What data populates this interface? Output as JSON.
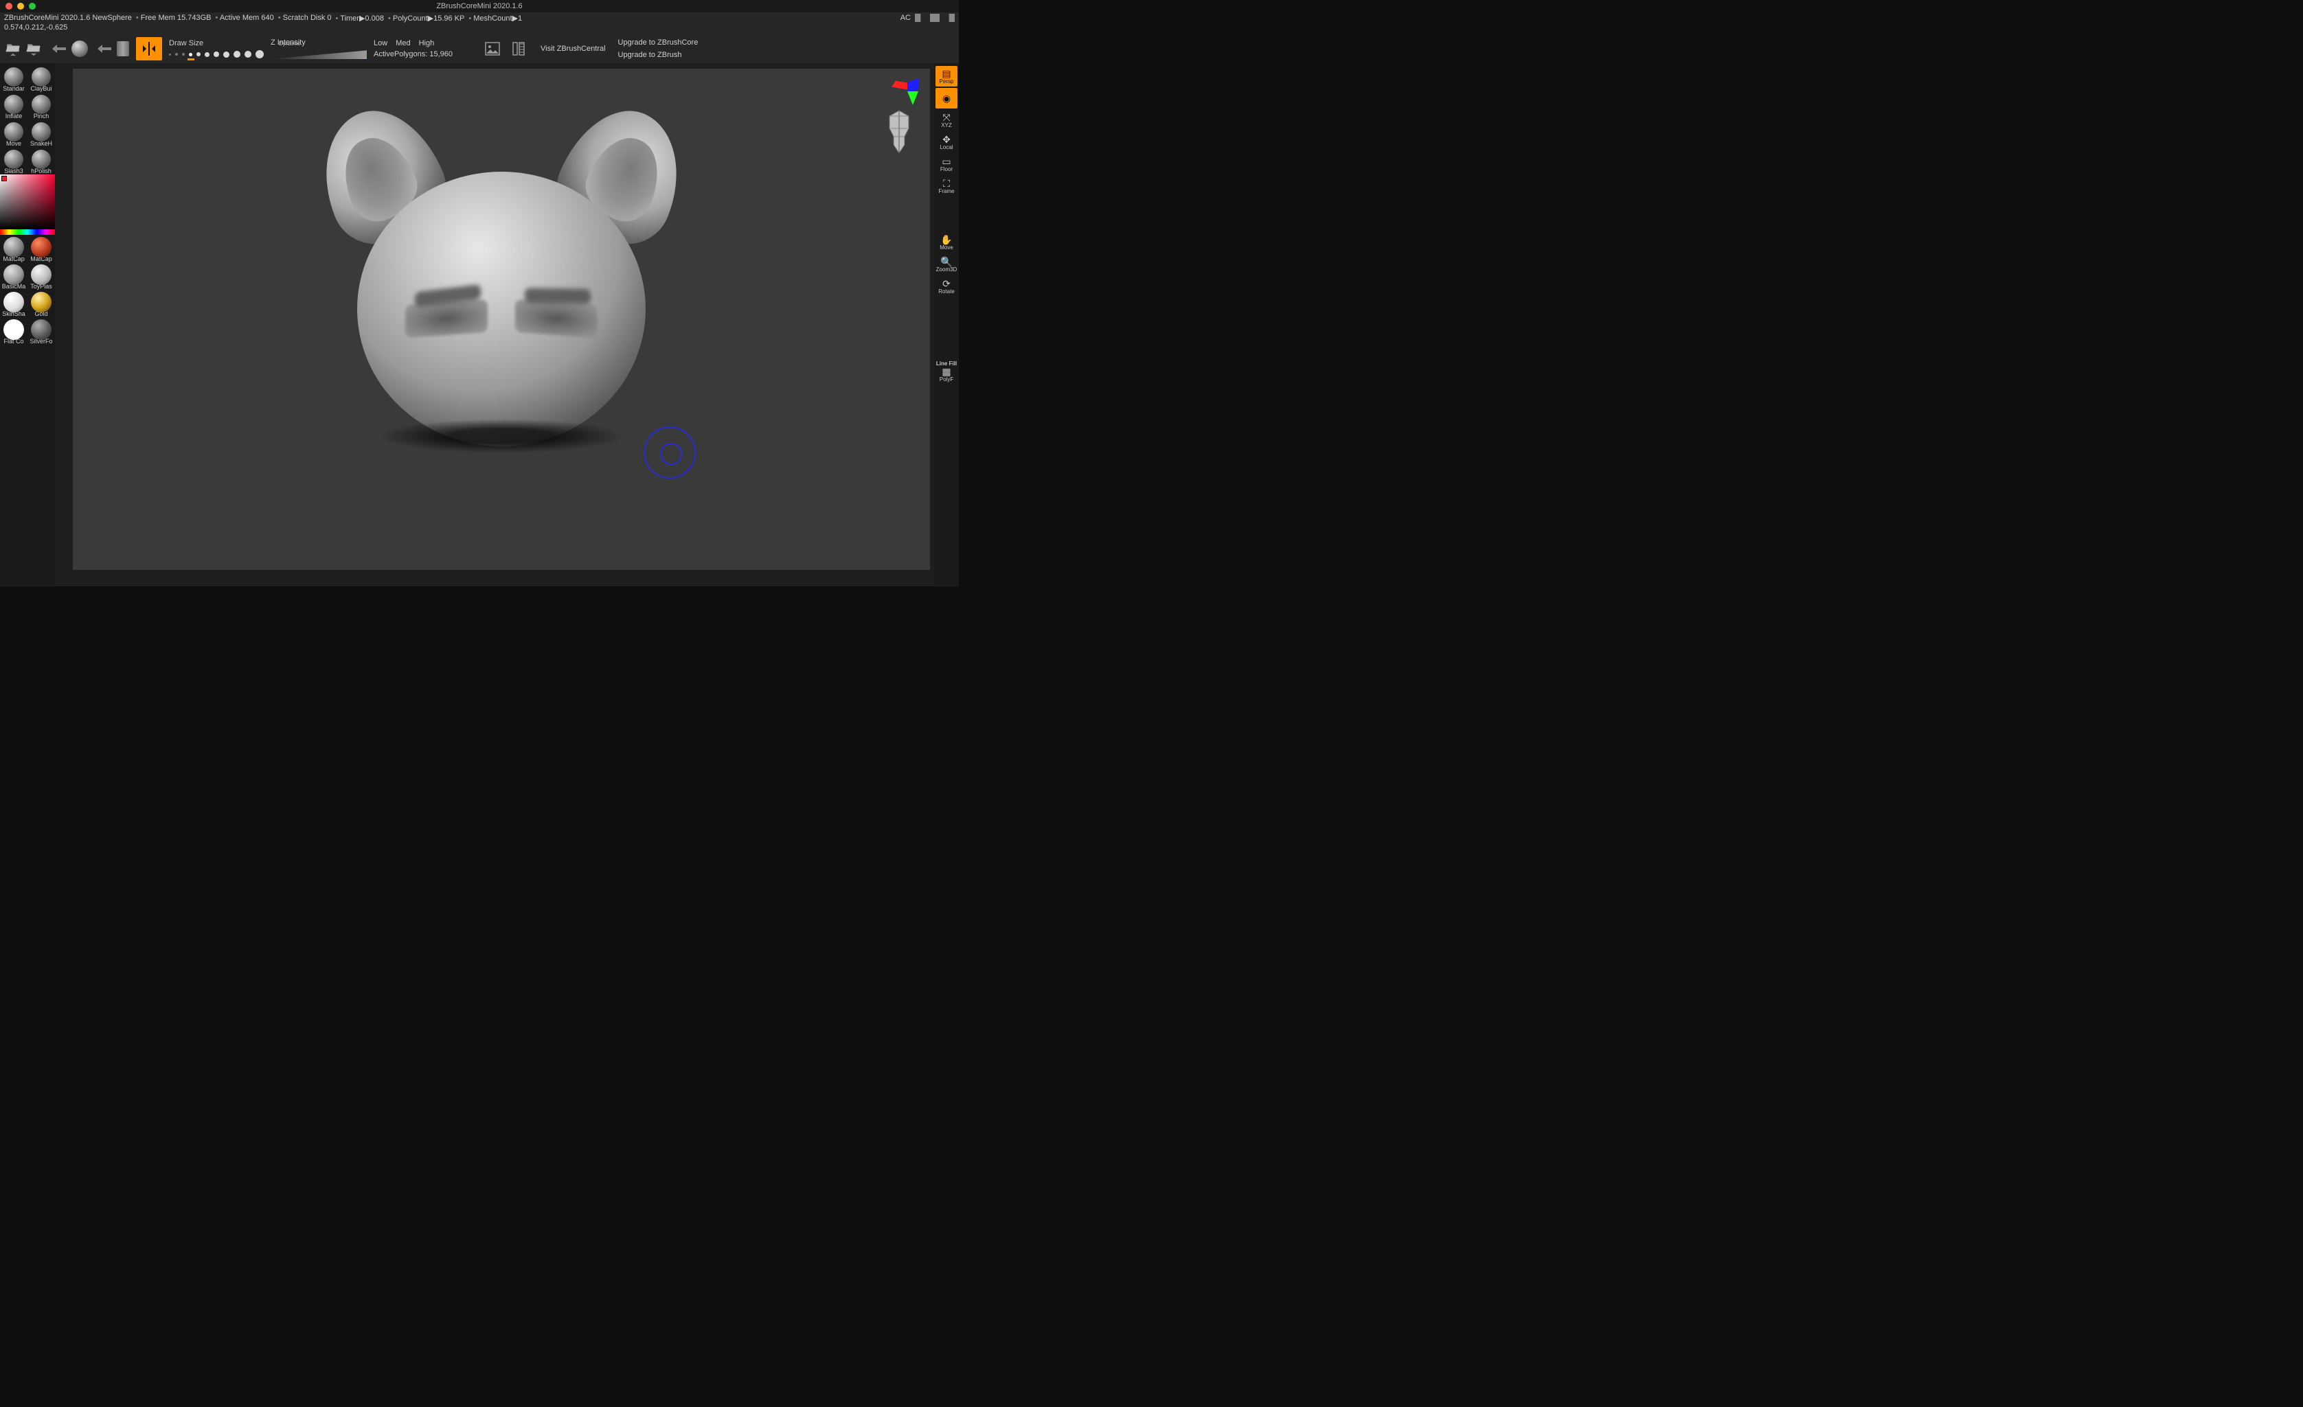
{
  "titlebar": {
    "app_title": "ZBrushCoreMini 2020.1.6"
  },
  "status": {
    "app_doc": "ZBrushCoreMini 2020.1.6 NewSphere",
    "free_mem": "Free Mem 15.743GB",
    "active_mem": "Active Mem 640",
    "scratch": "Scratch Disk 0",
    "timer": "Timer▶0.008",
    "polycount": "PolyCount▶15.96 KP",
    "meshcount": "MeshCount▶1",
    "ac": "AC"
  },
  "coords": "0.574,0.212,-0.625",
  "toolbar": {
    "draw_size_label": "Draw Size",
    "dynamic_label": "Dynamic",
    "zintensity_label": "Z Intensity",
    "res": {
      "low": "Low",
      "med": "Med",
      "high": "High"
    },
    "active_polys_label": "ActivePolygons:",
    "active_polys_value": "15,960",
    "visit": "Visit ZBrushCentral",
    "upgrade_core": "Upgrade to ZBrushCore",
    "upgrade_zbrush": "Upgrade to ZBrush"
  },
  "brushes": [
    {
      "label": "Standar"
    },
    {
      "label": "ClayBui"
    },
    {
      "label": "Inflate"
    },
    {
      "label": "Pinch"
    },
    {
      "label": "Move"
    },
    {
      "label": "SnakeH"
    },
    {
      "label": "Slash3"
    },
    {
      "label": "hPolish"
    }
  ],
  "materials": [
    {
      "label": "MatCap",
      "bg": "radial-gradient(circle at 35% 30%,#d8d8d8,#7a7a7a 60%,#2a2a2a)"
    },
    {
      "label": "MatCap",
      "bg": "radial-gradient(circle at 35% 30%,#ff8a60,#b63a1e 55%,#3a0e06)"
    },
    {
      "label": "BasicMa",
      "bg": "radial-gradient(circle at 35% 30%,#e0e0e0,#9a9a9a 55%,#3a3a3a)"
    },
    {
      "label": "ToyPlas",
      "bg": "radial-gradient(circle at 35% 30%,#f5f5f5,#bcbcbc 55%,#5a5a5a)"
    },
    {
      "label": "SkinSha",
      "bg": "radial-gradient(circle at 35% 30%,#ffffff,#dedede 55%,#8a8a8a)"
    },
    {
      "label": "Gold",
      "bg": "radial-gradient(circle at 35% 30%,#fff1a6,#d6a51e 50%,#5a3b05)"
    },
    {
      "label": "Flat Co",
      "bg": "radial-gradient(circle at 35% 30%,#ffffff,#ffffff 60%,#e6e6e6)"
    },
    {
      "label": "SilverFo",
      "bg": "radial-gradient(circle at 35% 30%,#aeaeae,#5c5c5c 55%,#1e1e1e)"
    }
  ],
  "rightbar": {
    "persp": "Persp",
    "xyz": "XYZ",
    "local": "Local",
    "floor": "Floor",
    "frame": "Frame",
    "move": "Move",
    "zoom": "Zoom3D",
    "rotate": "Rotate",
    "linefill": "Line Fill",
    "polyf": "PolyF"
  }
}
